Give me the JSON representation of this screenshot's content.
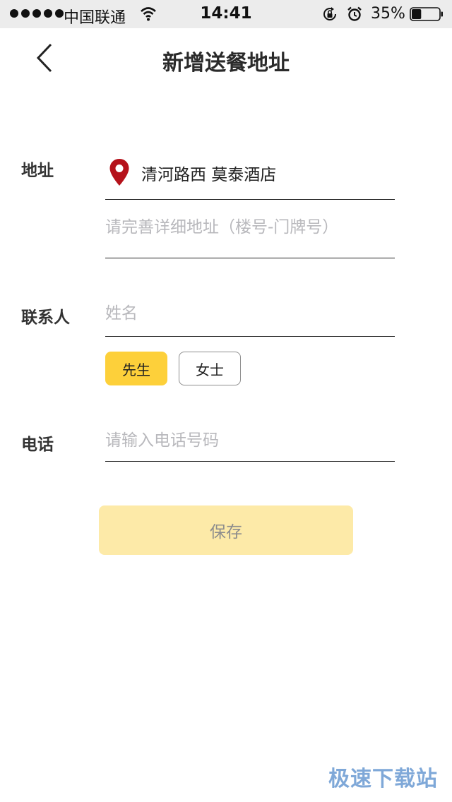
{
  "status_bar": {
    "carrier": "中国联通",
    "time": "14:41",
    "battery_percent": "35%",
    "battery_level": 0.35,
    "icons": [
      "signal-dots",
      "wifi-icon",
      "rotation-lock-icon",
      "alarm-icon",
      "battery-icon"
    ]
  },
  "header": {
    "back_icon": "chevron-left-icon",
    "title": "新增送餐地址"
  },
  "form": {
    "address": {
      "label": "地址",
      "location_icon": "map-pin-icon",
      "location_icon_color": "#b5121b",
      "selected_location": "清河路西 莫泰酒店",
      "detail_placeholder": "请完善详细地址（楼号-门牌号）"
    },
    "contact": {
      "label": "联系人",
      "name_placeholder": "姓名",
      "gender_options": [
        "先生",
        "女士"
      ],
      "selected_gender": "先生"
    },
    "phone": {
      "label": "电话",
      "placeholder": "请输入电话号码"
    }
  },
  "save_button": {
    "label": "保存",
    "state": "disabled"
  },
  "colors": {
    "accent": "#fdd03a",
    "save_disabled_bg": "#fdeaa8",
    "placeholder": "#b8b8bc"
  },
  "watermark": "极速下载站"
}
